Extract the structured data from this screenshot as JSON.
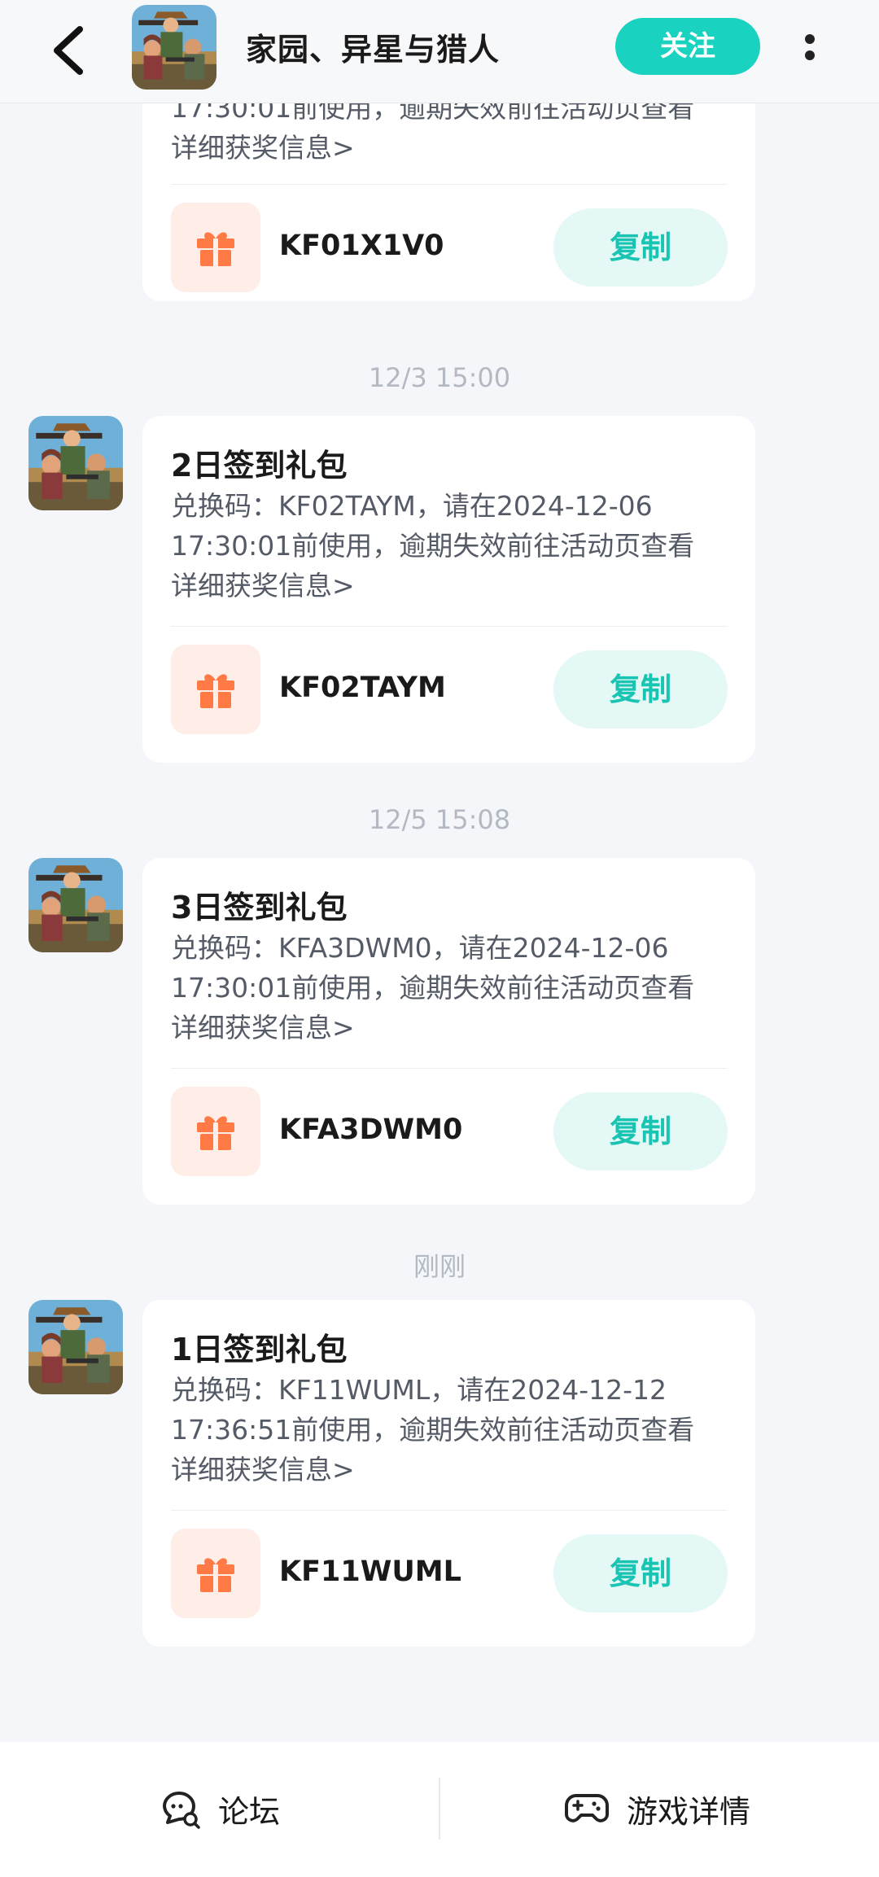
{
  "header": {
    "title": "家园、异星与猎人",
    "follow_label": "关注"
  },
  "partial_card": {
    "desc_tail": "17:30:01前使用，逾期失效前往活动页查看",
    "desc_link": "详细获奖信息>",
    "code": "KF01X1V0",
    "copy_label": "复制"
  },
  "messages": [
    {
      "time": "12/3  15:00",
      "title": "2日签到礼包",
      "desc_line1": "兑换码：KF02TAYM，请在2024-12-06",
      "desc_line2": "17:30:01前使用，逾期失效前往活动页查看",
      "desc_link": "详细获奖信息>",
      "code": "KF02TAYM",
      "copy_label": "复制"
    },
    {
      "time": "12/5  15:08",
      "title": "3日签到礼包",
      "desc_line1": "兑换码：KFA3DWM0，请在2024-12-06",
      "desc_line2": "17:30:01前使用，逾期失效前往活动页查看",
      "desc_link": "详细获奖信息>",
      "code": "KFA3DWM0",
      "copy_label": "复制"
    },
    {
      "time": "刚刚",
      "title": "1日签到礼包",
      "desc_line1": "兑换码：KF11WUML，请在2024-12-12",
      "desc_line2": "17:36:51前使用，逾期失效前往活动页查看",
      "desc_link": "详细获奖信息>",
      "code": "KF11WUML",
      "copy_label": "复制"
    }
  ],
  "bottom_bar": {
    "forum_label": "论坛",
    "game_detail_label": "游戏详情"
  },
  "colors": {
    "accent": "#19d3c0",
    "gift_bg": "#ffeee8",
    "gift_icon": "#ff7a45",
    "copy_bg": "#e4f8f6"
  }
}
